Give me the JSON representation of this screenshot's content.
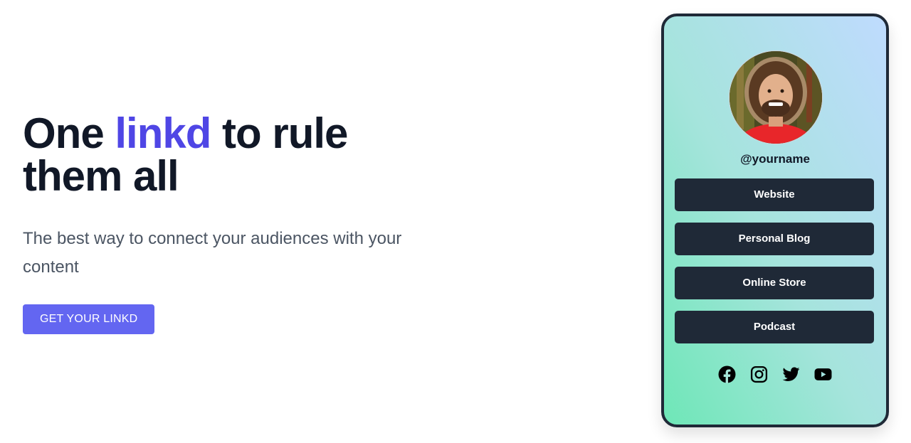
{
  "hero": {
    "title_before": "One ",
    "title_accent": "linkd",
    "title_after": " to rule them all",
    "subtitle": "The best way to connect your audiences with your content",
    "cta_label": "GET YOUR LINKD"
  },
  "profile": {
    "username": "@yourname",
    "links": [
      {
        "label": "Website"
      },
      {
        "label": "Personal Blog"
      },
      {
        "label": "Online Store"
      },
      {
        "label": "Podcast"
      }
    ],
    "socials": [
      "facebook-icon",
      "instagram-icon",
      "twitter-icon",
      "youtube-icon"
    ]
  },
  "colors": {
    "accent": "#4f46e5",
    "cta": "#6366f1",
    "dark": "#1f2937",
    "gradient_from": "#6ee7b7",
    "gradient_to": "#bfdbfe"
  }
}
